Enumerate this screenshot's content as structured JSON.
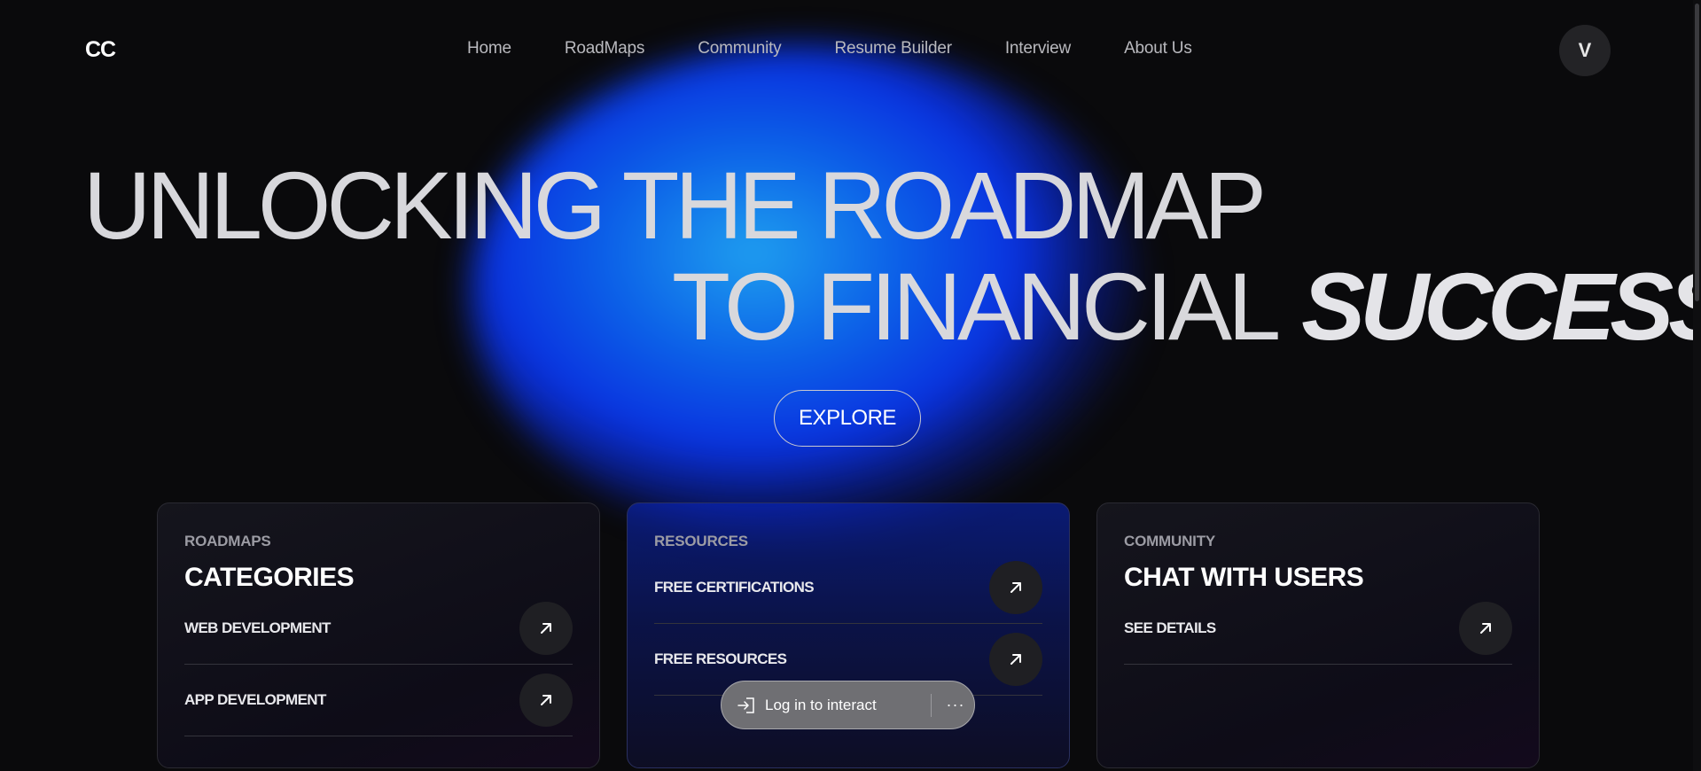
{
  "header": {
    "logo": "CC",
    "nav": [
      "Home",
      "RoadMaps",
      "Community",
      "Resume Builder",
      "Interview",
      "About Us"
    ],
    "avatar_initial": "V"
  },
  "hero": {
    "line1": "UNLOCKING THE ROADMAP",
    "line2": "TO FINANCIAL",
    "line2_accent": "SUCCESS",
    "cta_label": "EXPLORE"
  },
  "cards": [
    {
      "tag": "ROADMAPS",
      "title": "CATEGORIES",
      "rows": [
        "WEB DEVELOPMENT",
        "APP DEVELOPMENT"
      ]
    },
    {
      "tag": "RESOURCES",
      "title": "",
      "rows": [
        "FREE CERTIFICATIONS",
        "FREE RESOURCES"
      ]
    },
    {
      "tag": "COMMUNITY",
      "title": "CHAT WITH USERS",
      "rows": [
        "SEE DETAILS"
      ]
    }
  ],
  "login_toast": {
    "text": "Log in to interact",
    "more_label": "···"
  },
  "colors": {
    "background": "#0a0a0c",
    "glow_core": "#1fa0ef",
    "glow_blue": "#0a32e0",
    "text_primary": "#ffffff",
    "text_muted": "#b9b9be",
    "arrow_button": "#1f1f23"
  },
  "icons": {
    "row_arrow": "arrow-up-right-icon",
    "toast": "sign-in-icon"
  }
}
